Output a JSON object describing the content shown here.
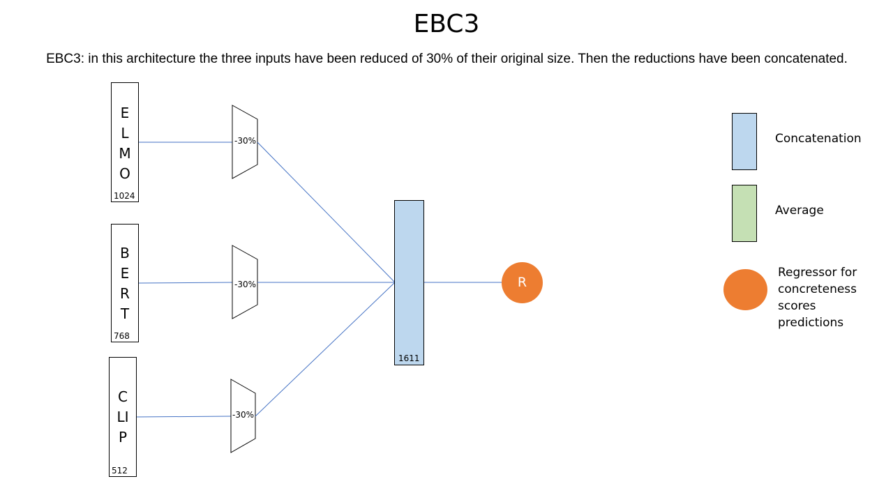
{
  "title": "EBC3",
  "subtitle": "EBC3: in this architecture the three inputs have been reduced of 30% of their original size. Then the reductions have been concatenated.",
  "inputs": [
    {
      "name": "E\nL\nM\nO",
      "size": "1024"
    },
    {
      "name": "B\nE\nR\nT",
      "size": "768"
    },
    {
      "name": "C\nLI\nP",
      "size": "512"
    }
  ],
  "reducers": [
    {
      "label": "-30%"
    },
    {
      "label": "-30%"
    },
    {
      "label": "-30%"
    }
  ],
  "concat": {
    "size": "1611",
    "color": "#bdd7ee"
  },
  "regressor": {
    "label": "R",
    "color": "#ed7d31"
  },
  "legend": {
    "concatenation": {
      "label": "Concatenation",
      "color": "#bdd7ee"
    },
    "average": {
      "label": "Average",
      "color": "#c5e0b4"
    },
    "regressor": {
      "label": "Regressor for\nconcreteness\nscores\npredictions",
      "color": "#ed7d31"
    }
  },
  "colors": {
    "connector": "#4472c4"
  }
}
